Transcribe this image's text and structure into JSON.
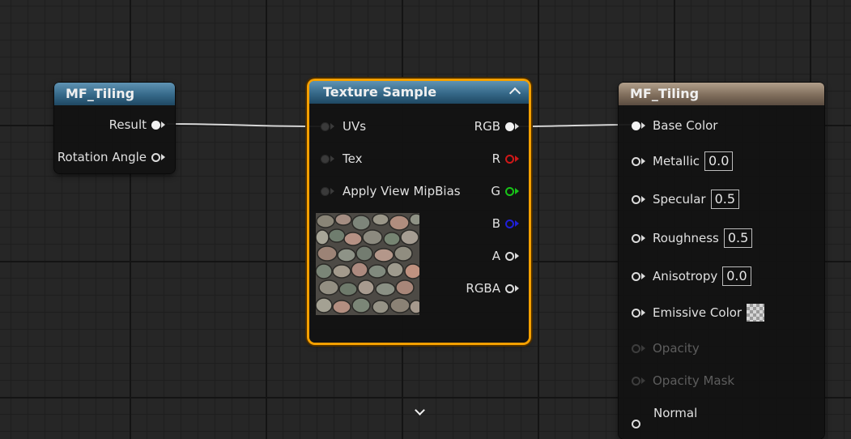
{
  "nodes": {
    "mf_left": {
      "title": "MF_Tiling",
      "outputs": [
        "Result",
        "Rotation Angle"
      ]
    },
    "texture_sample": {
      "title": "Texture Sample",
      "inputs": [
        "UVs",
        "Tex",
        "Apply View MipBias"
      ],
      "outputs": [
        "RGB",
        "R",
        "G",
        "B",
        "A",
        "RGBA"
      ]
    },
    "mf_right": {
      "title": "MF_Tiling",
      "inputs": [
        {
          "label": "Base Color"
        },
        {
          "label": "Metallic",
          "value": "0.0"
        },
        {
          "label": "Specular",
          "value": "0.5"
        },
        {
          "label": "Roughness",
          "value": "0.5"
        },
        {
          "label": "Anisotropy",
          "value": "0.0"
        },
        {
          "label": "Emissive Color"
        },
        {
          "label": "Opacity"
        },
        {
          "label": "Opacity Mask"
        },
        {
          "label": "Normal"
        }
      ]
    }
  },
  "icons": {
    "collapse": "chevron-up-icon",
    "expand": "chevron-down-icon"
  },
  "colors": {
    "header_blue": "#356888",
    "header_tan": "#806e5c",
    "selection": "#f5a000",
    "pin_red": "#d01818",
    "pin_green": "#18c418",
    "pin_blue": "#2020d8"
  }
}
